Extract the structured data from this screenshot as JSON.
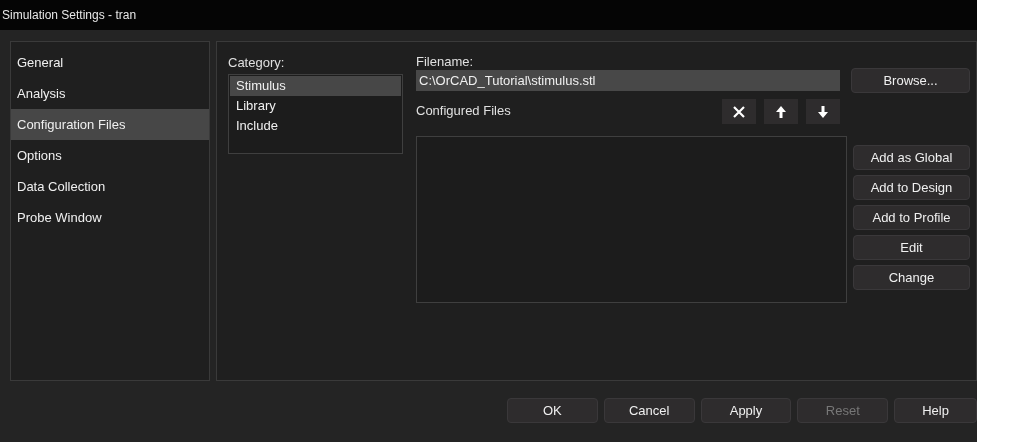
{
  "window": {
    "title": "Simulation Settings - tran"
  },
  "sidebar": {
    "items": [
      {
        "label": "General",
        "selected": false
      },
      {
        "label": "Analysis",
        "selected": false
      },
      {
        "label": "Configuration Files",
        "selected": true
      },
      {
        "label": "Options",
        "selected": false
      },
      {
        "label": "Data Collection",
        "selected": false
      },
      {
        "label": "Probe Window",
        "selected": false
      }
    ]
  },
  "category": {
    "label": "Category:",
    "items": [
      {
        "label": "Stimulus",
        "selected": true
      },
      {
        "label": "Library",
        "selected": false
      },
      {
        "label": "Include",
        "selected": false
      }
    ]
  },
  "filename": {
    "label": "Filename:",
    "value": "C:\\OrCAD_Tutorial\\stimulus.stl",
    "browse": "Browse..."
  },
  "configured_files": {
    "label": "Configured Files",
    "tools": [
      {
        "kind": "delete"
      },
      {
        "kind": "up"
      },
      {
        "kind": "down"
      }
    ]
  },
  "actions": [
    {
      "label": "Add as Global",
      "disabled": false
    },
    {
      "label": "Add to Design",
      "disabled": false
    },
    {
      "label": "Add to Profile",
      "disabled": false
    },
    {
      "label": "Edit",
      "disabled": false
    },
    {
      "label": "Change",
      "disabled": false
    }
  ],
  "footer": [
    {
      "label": "OK",
      "disabled": false
    },
    {
      "label": "Cancel",
      "disabled": false
    },
    {
      "label": "Apply",
      "disabled": false
    },
    {
      "label": "Reset",
      "disabled": true
    },
    {
      "label": "Help",
      "disabled": false
    }
  ]
}
